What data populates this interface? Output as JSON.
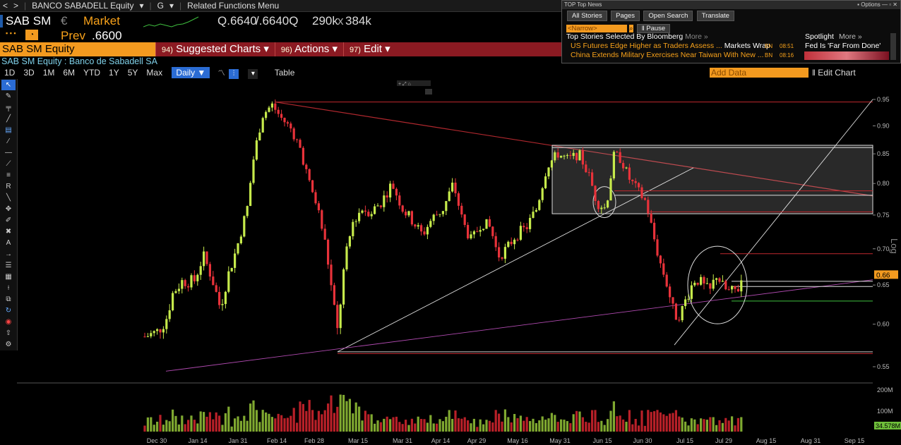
{
  "topbar": {
    "back": "<",
    "fwd": ">",
    "security": "BANCO SABADELL Equity",
    "menu_g": "G",
    "related": "Related Functions Menu"
  },
  "quote": {
    "ticker": "SAB SM",
    "currency": "€",
    "status": "Market",
    "bid": "Q.6640",
    "ask": "/.6640Q",
    "size": "290k",
    "x": "x",
    "size2": "384k",
    "prev_label": "Prev",
    "prev_value": ".6600"
  },
  "redbar": {
    "equity": "SAB SM Equity",
    "suggested": "Suggested Charts",
    "suggested_num": "94)",
    "actions": "Actions",
    "actions_num": "96)",
    "edit": "Edit",
    "edit_num": "97)"
  },
  "subtitle": "SAB SM Equity : Banco de Sabadell SA",
  "toolbar": {
    "periods": [
      "1D",
      "3D",
      "1M",
      "6M",
      "YTD",
      "1Y",
      "5Y",
      "Max"
    ],
    "freq": "Daily ▼",
    "table": "Table",
    "add_data": "Add Data",
    "edit_chart": "Edit Chart"
  },
  "news": {
    "title": "TOP Top News",
    "options": "Options",
    "buttons": [
      "All Stories",
      "Pages",
      "Open Search",
      "Translate"
    ],
    "narrow": "<Narrow>",
    "pause": "Pause",
    "heading": "Top Stories Selected By Bloomberg",
    "more": "More »",
    "spotlight": "Spotlight",
    "spot_more": "More »",
    "stories": [
      {
        "text": "US Futures Edge Higher as Traders Assess ...",
        "tag": "Markets Wrap",
        "src": "BN",
        "time": "08:51"
      },
      {
        "text": "China Extends Military Exercises Near Taiwan With New ...",
        "tag": "",
        "src": "BN",
        "time": "08:16"
      }
    ],
    "spot_story": "Fed Is 'Far From Done'"
  },
  "chart_data": {
    "type": "candlestick",
    "scale": "Log",
    "price_ticks": [
      "0.95",
      "0.90",
      "0.85",
      "0.80",
      "0.75",
      "0.70",
      "0.65",
      "0.60",
      "0.55"
    ],
    "price_values": [
      0.95,
      0.9,
      0.85,
      0.8,
      0.75,
      0.7,
      0.65,
      0.6,
      0.55
    ],
    "last_price": "0.66",
    "volume_ticks": [
      "200M",
      "100M"
    ],
    "last_volume": "34.578M",
    "dates": [
      "Dec 30",
      "Jan 14",
      "Jan 31",
      "Feb 14",
      "Feb 28",
      "Mar 15",
      "Mar 31",
      "Apr 14",
      "Apr 29",
      "May 16",
      "May 31",
      "Jun 15",
      "Jun 30",
      "Jul 15",
      "Jul 29",
      "Aug 15",
      "Aug 31",
      "Sep 15"
    ],
    "ylim": [
      0.55,
      0.95
    ]
  },
  "colors": {
    "up": "#c6ea4b",
    "down": "#e8323a",
    "accent": "#f39a1f",
    "highlight": "#2b6cd4"
  }
}
